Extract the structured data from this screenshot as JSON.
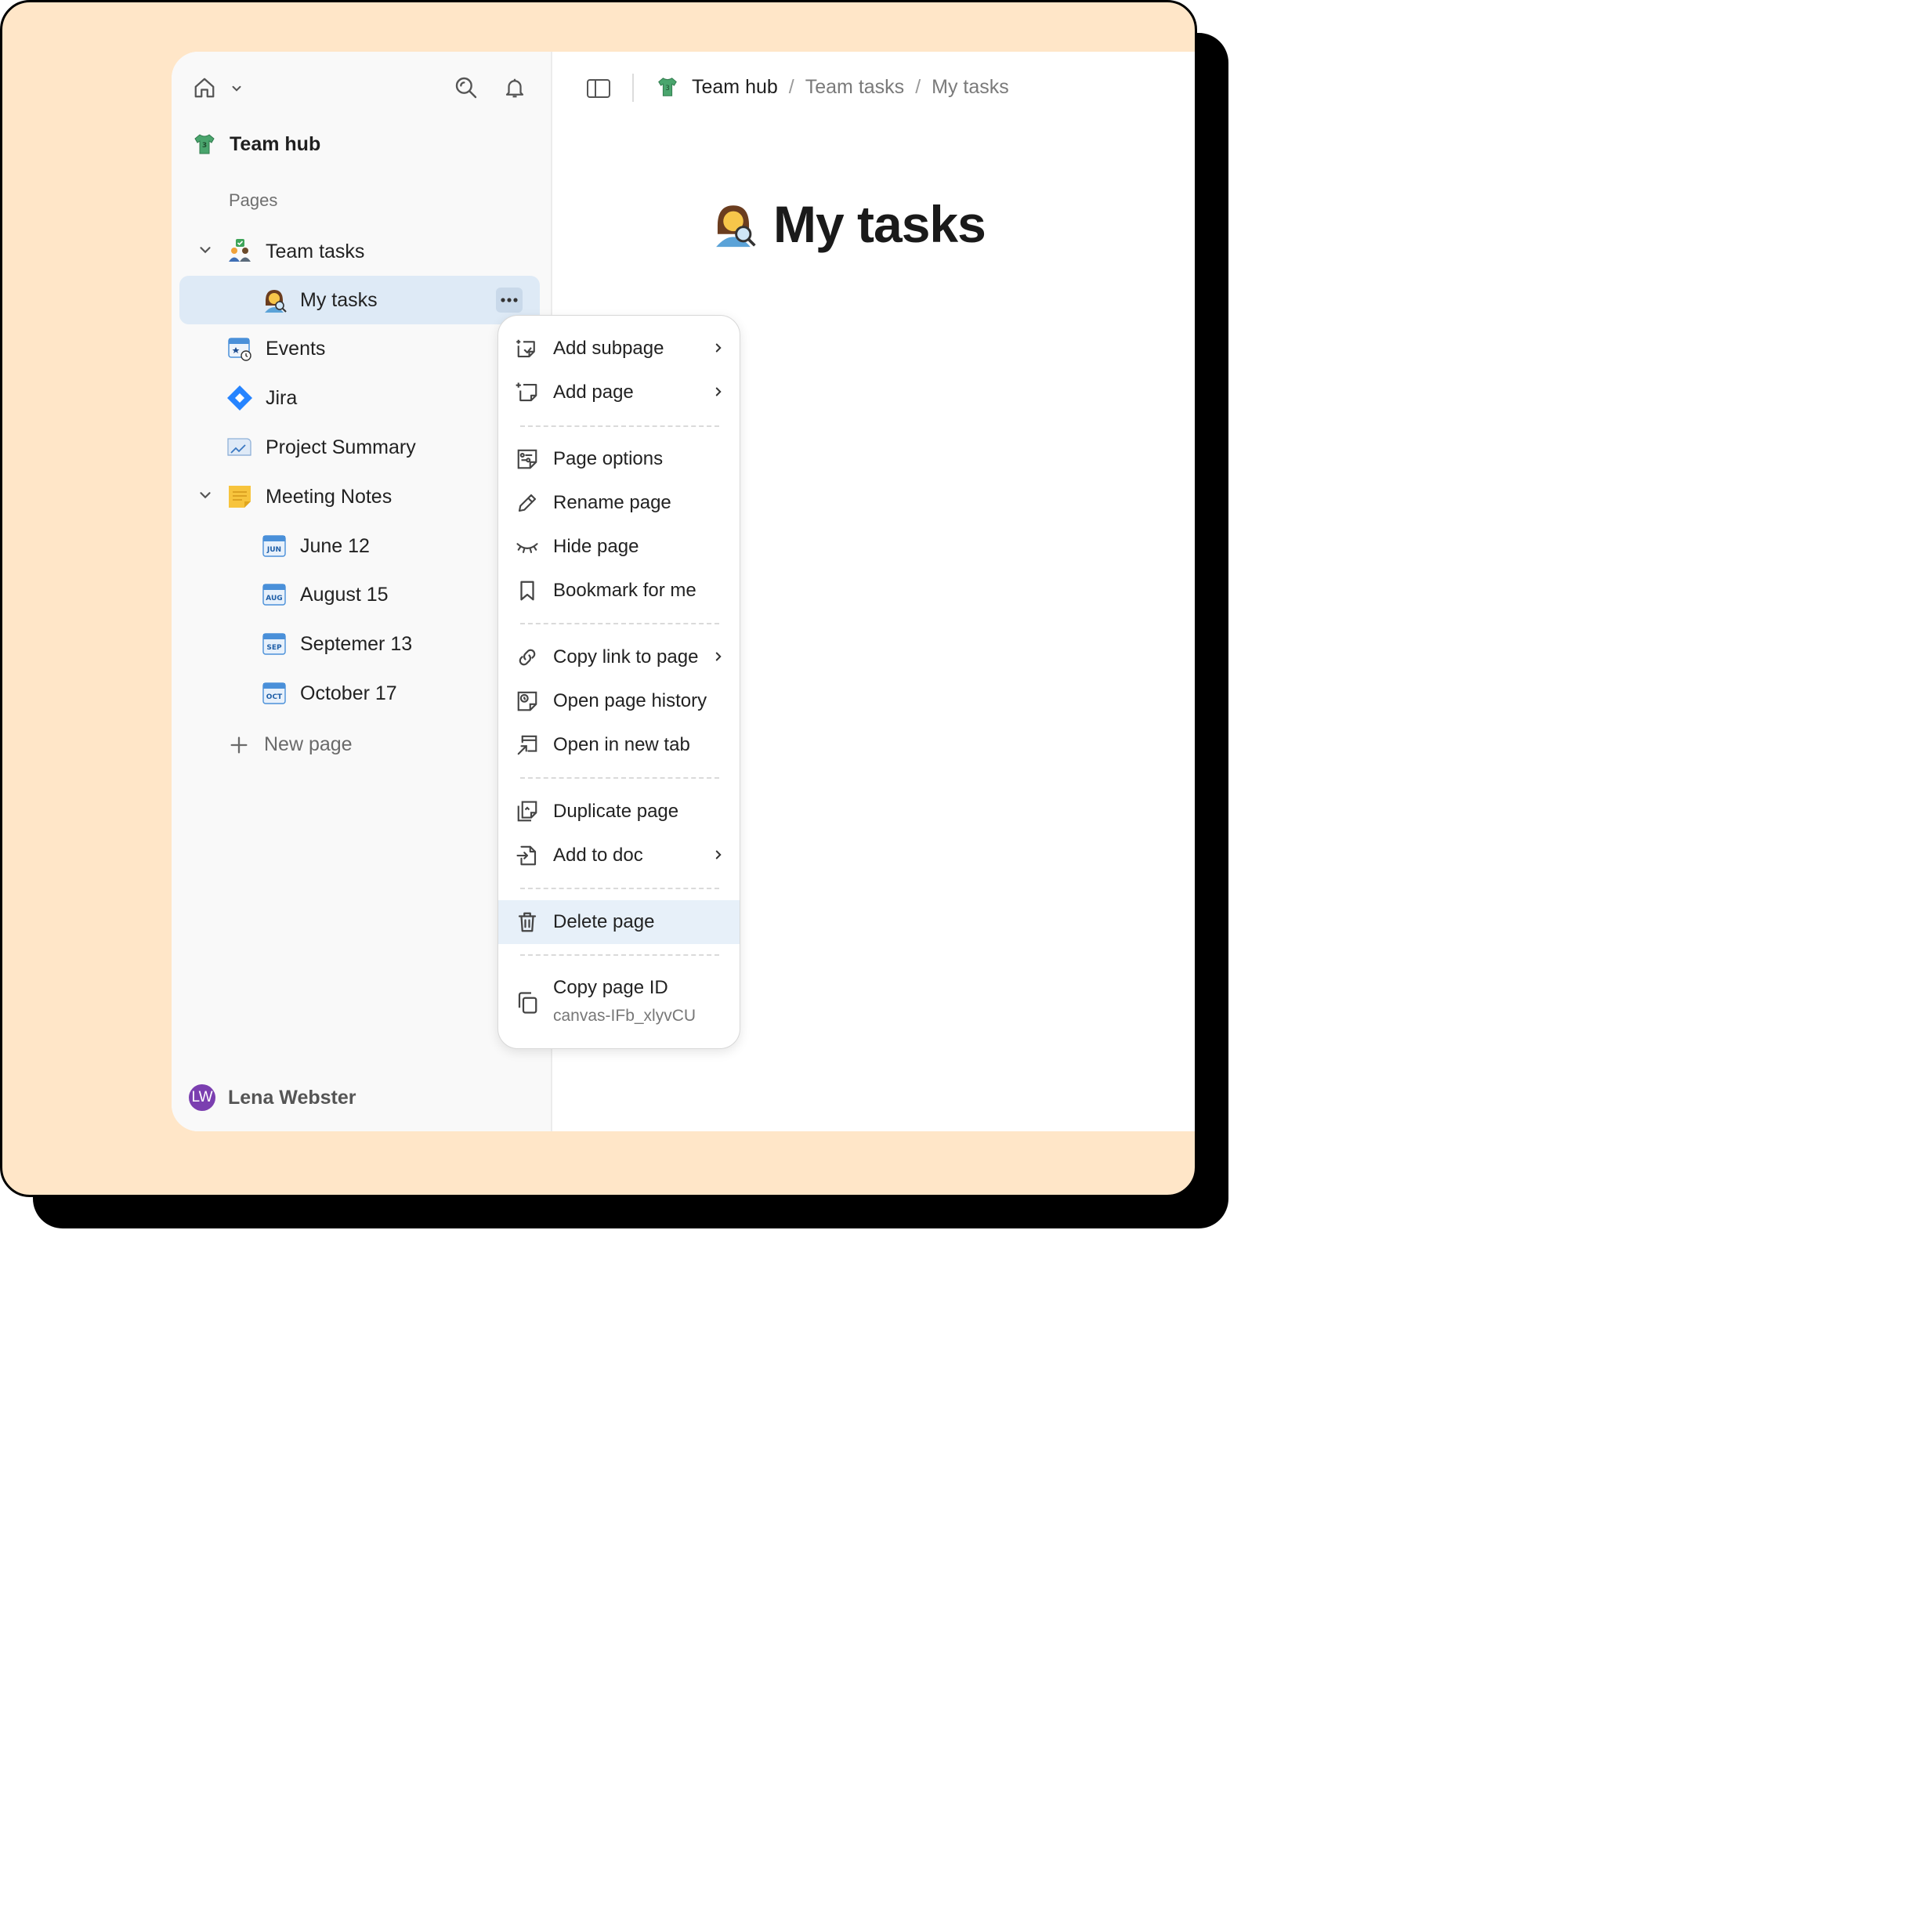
{
  "sidebar": {
    "workspace_name": "Team hub",
    "section_label": "Pages",
    "items": [
      {
        "label": "Team tasks"
      },
      {
        "label": "My tasks"
      },
      {
        "label": "Events"
      },
      {
        "label": "Jira"
      },
      {
        "label": "Project Summary"
      },
      {
        "label": "Meeting Notes"
      },
      {
        "label": "June 12",
        "badge": "JUN"
      },
      {
        "label": "August 15",
        "badge": "AUG"
      },
      {
        "label": "Septemer 13",
        "badge": "SEP"
      },
      {
        "label": "October 17",
        "badge": "OCT"
      }
    ],
    "new_page_label": "New page",
    "user": {
      "initials": "LW",
      "name": "Lena Webster"
    }
  },
  "breadcrumb": [
    "Team hub",
    "Team tasks",
    "My tasks"
  ],
  "page": {
    "title": "My tasks"
  },
  "context_menu": {
    "items": [
      {
        "label": "Add subpage"
      },
      {
        "label": "Add page"
      },
      {
        "label": "Page options"
      },
      {
        "label": "Rename page"
      },
      {
        "label": "Hide page"
      },
      {
        "label": "Bookmark for me"
      },
      {
        "label": "Copy link to page"
      },
      {
        "label": "Open page history"
      },
      {
        "label": "Open in new tab"
      },
      {
        "label": "Duplicate page"
      },
      {
        "label": "Add to doc"
      },
      {
        "label": "Delete page"
      },
      {
        "label": "Copy page ID",
        "sub": "canvas-IFb_xlyvCU"
      }
    ]
  },
  "colors": {
    "frame_background": "#ffe6c8",
    "sidebar_background": "#f9f9f9",
    "active_item": "#deeaf6",
    "menu_highlight": "#e7f0f9",
    "avatar": "#7b3fb0",
    "jira_blue": "#2684ff"
  }
}
